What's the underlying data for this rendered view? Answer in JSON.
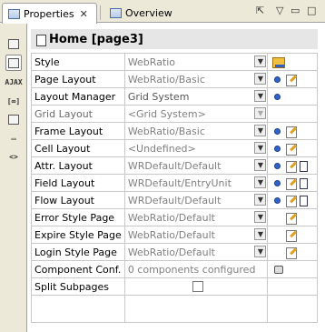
{
  "tabs": [
    {
      "label": "Properties",
      "icon": "properties-icon",
      "active": true
    },
    {
      "label": "Overview",
      "icon": "overview-icon",
      "active": false
    }
  ],
  "header": {
    "title": "Home [page3]"
  },
  "left_toolbar": {
    "items": [
      {
        "icon": "list-icon"
      },
      {
        "icon": "page-icon",
        "selected": true
      },
      {
        "label": "AJAX",
        "icon": "ajax-icon"
      },
      {
        "icon": "link-icon"
      },
      {
        "icon": "monitor-icon"
      },
      {
        "icon": "comment-icon"
      },
      {
        "icon": "code-icon"
      }
    ]
  },
  "properties": [
    {
      "name": "Style",
      "value": "WebRatio",
      "actions": [
        "folder-edit"
      ],
      "enabled": true
    },
    {
      "name": "Page Layout",
      "value": "WebRatio/Basic",
      "actions": [
        "dot",
        "edit"
      ],
      "enabled": true
    },
    {
      "name": "Layout Manager",
      "value": "Grid System",
      "actions": [
        "dot"
      ],
      "enabled": true
    },
    {
      "name": "Grid Layout",
      "value": "<Grid System>",
      "actions": [],
      "enabled": false
    },
    {
      "name": "Frame Layout",
      "value": "WebRatio/Basic",
      "actions": [
        "dot",
        "edit"
      ],
      "enabled": true
    },
    {
      "name": "Cell Layout",
      "value": "<Undefined>",
      "actions": [
        "dot",
        "edit"
      ],
      "enabled": true
    },
    {
      "name": "Attr. Layout",
      "value": "WRDefault/Default",
      "actions": [
        "dot",
        "edit",
        "doc"
      ],
      "enabled": true
    },
    {
      "name": "Field Layout",
      "value": "WRDefault/EntryUnit",
      "actions": [
        "dot",
        "edit",
        "doc"
      ],
      "enabled": true
    },
    {
      "name": "Flow Layout",
      "value": "WRDefault/Default",
      "actions": [
        "dot",
        "edit",
        "doc"
      ],
      "enabled": true
    },
    {
      "name": "Error Style Page",
      "value": "WebRatio/Default",
      "actions": [
        "edit"
      ],
      "enabled": true
    },
    {
      "name": "Expire Style Page",
      "value": "WebRatio/Default",
      "actions": [
        "edit"
      ],
      "enabled": true
    },
    {
      "name": "Login Style Page",
      "value": "WebRatio/Default",
      "actions": [
        "edit"
      ],
      "enabled": true
    },
    {
      "name": "Component Conf.",
      "value": "0 components configured",
      "actions": [
        "box"
      ],
      "enabled": true,
      "no_dropdown": true
    },
    {
      "name": "Split Subpages",
      "value": "",
      "checkbox": true,
      "checked": false,
      "actions": [],
      "enabled": true
    }
  ]
}
